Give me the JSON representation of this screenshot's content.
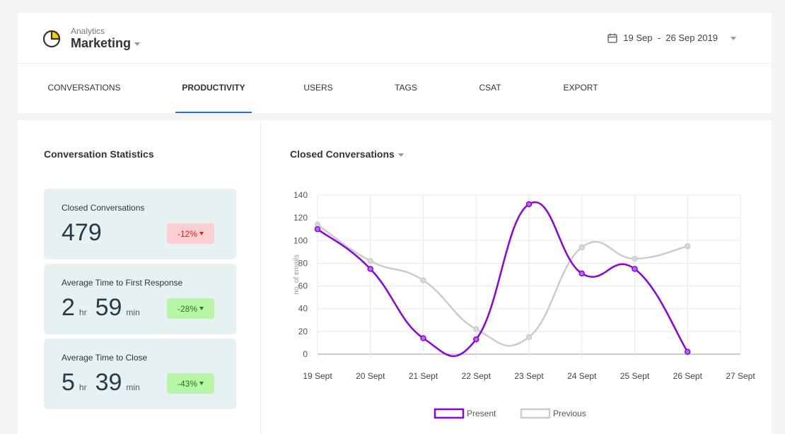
{
  "brand": {
    "subtitle": "Analytics",
    "title": "Marketing",
    "logo_icon": "pie-chart-icon"
  },
  "date_range": {
    "label": "19 Sep  -  26 Sep 2019",
    "icon": "calendar-icon"
  },
  "tabs": [
    {
      "label": "CONVERSATIONS",
      "active": false
    },
    {
      "label": "PRODUCTIVITY",
      "active": true
    },
    {
      "label": "USERS",
      "active": false
    },
    {
      "label": "TAGS",
      "active": false
    },
    {
      "label": "CSAT",
      "active": false
    },
    {
      "label": "EXPORT",
      "active": false
    }
  ],
  "stats": {
    "title": "Conversation Statistics",
    "closed": {
      "label": "Closed Conversations",
      "value": "479",
      "change": "-12%"
    },
    "first_response": {
      "label": "Average Time to First Response",
      "hours": "2",
      "hr_unit": "hr",
      "minutes": "59",
      "min_unit": "min",
      "change": "-28%"
    },
    "close_time": {
      "label": "Average Time to Close",
      "hours": "5",
      "hr_unit": "hr",
      "minutes": "39",
      "min_unit": "min",
      "change": "-43%"
    }
  },
  "colors": {
    "accent": "#2f6bde",
    "present": "#8b00e8",
    "previous": "#cccccc",
    "card_bg": "#e6f2f2",
    "negative_bg": "#fbcfd2",
    "positive_bg": "#b9f5a6"
  },
  "chart_title": "Closed Conversations",
  "chart_data": {
    "type": "line",
    "categories": [
      "19 Sept",
      "20 Sept",
      "21 Sept",
      "22 Sept",
      "23 Sept",
      "24 Sept",
      "25 Sept",
      "26 Sept",
      "27 Sept"
    ],
    "ylabel": "no. of emails",
    "ylim": [
      0,
      140
    ],
    "yticks": [
      0,
      20,
      40,
      60,
      80,
      100,
      120,
      140
    ],
    "grid": true,
    "legend": "bottom",
    "series": [
      {
        "name": "Present",
        "values": [
          110,
          75,
          14,
          13,
          132,
          71,
          75,
          2
        ]
      },
      {
        "name": "Previous",
        "values": [
          114,
          82,
          65,
          22,
          15,
          94,
          84,
          95
        ]
      }
    ]
  }
}
